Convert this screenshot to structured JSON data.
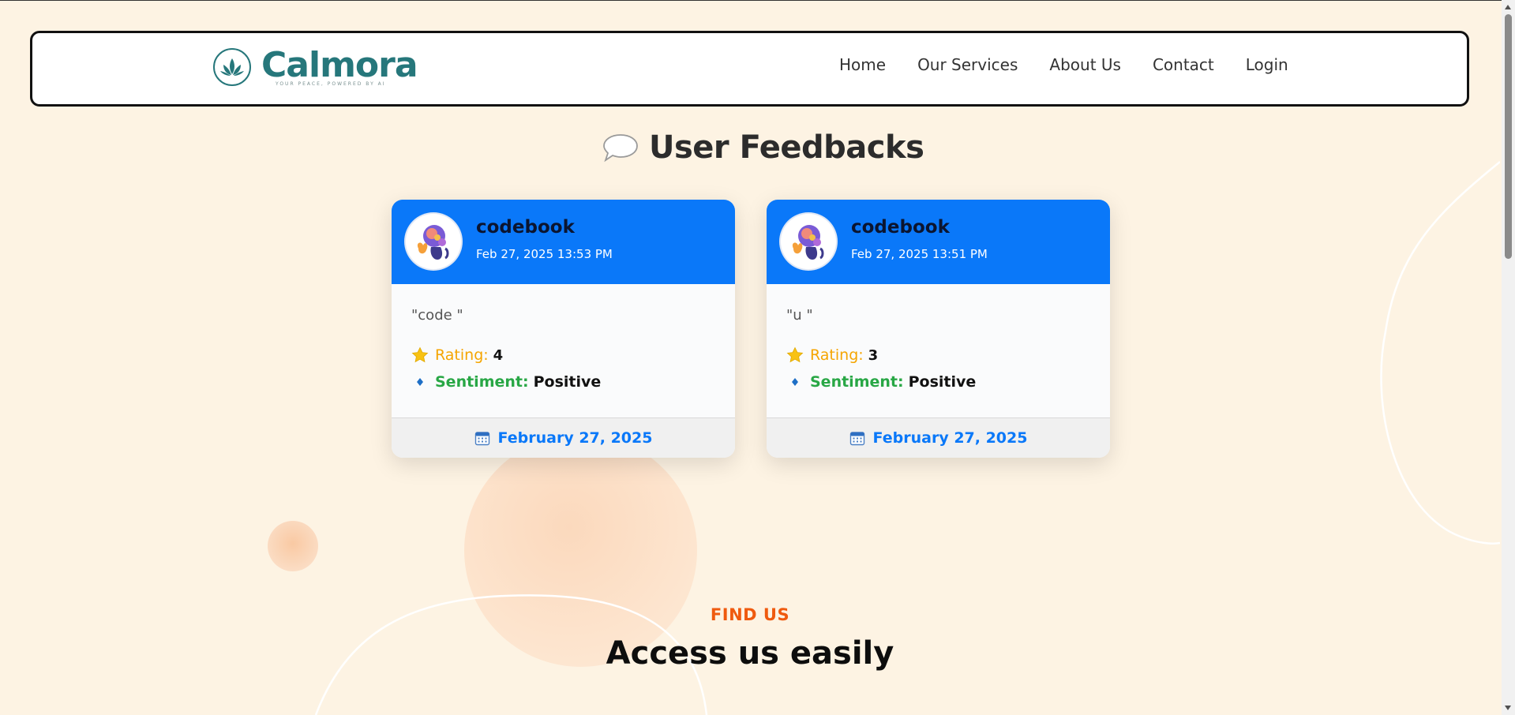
{
  "brand": {
    "name": "Calmora",
    "tagline": "YOUR PEACE, POWERED BY AI",
    "accent": "#26777b"
  },
  "nav": {
    "links": [
      "Home",
      "Our Services",
      "About Us",
      "Contact",
      "Login"
    ]
  },
  "section": {
    "icon": "speech-bubble-icon",
    "title": "User Feedbacks"
  },
  "feedbacks": [
    {
      "user": "codebook",
      "timestamp": "Feb 27, 2025 13:53 PM",
      "comment": "\"code \"",
      "rating_label": "Rating:",
      "rating": "4",
      "sentiment_label": "Sentiment:",
      "sentiment": "Positive",
      "date": "February 27, 2025"
    },
    {
      "user": "codebook",
      "timestamp": "Feb 27, 2025 13:51 PM",
      "comment": "\"u \"",
      "rating_label": "Rating:",
      "rating": "3",
      "sentiment_label": "Sentiment:",
      "sentiment": "Positive",
      "date": "February 27, 2025"
    }
  ],
  "find_us": {
    "label": "FIND US",
    "title": "Access us easily"
  },
  "colors": {
    "card_header": "#0a78f9",
    "rating": "#f5a500",
    "sentiment": "#28a745",
    "find_label": "#ef5a0f",
    "background": "#fdf3e3"
  }
}
